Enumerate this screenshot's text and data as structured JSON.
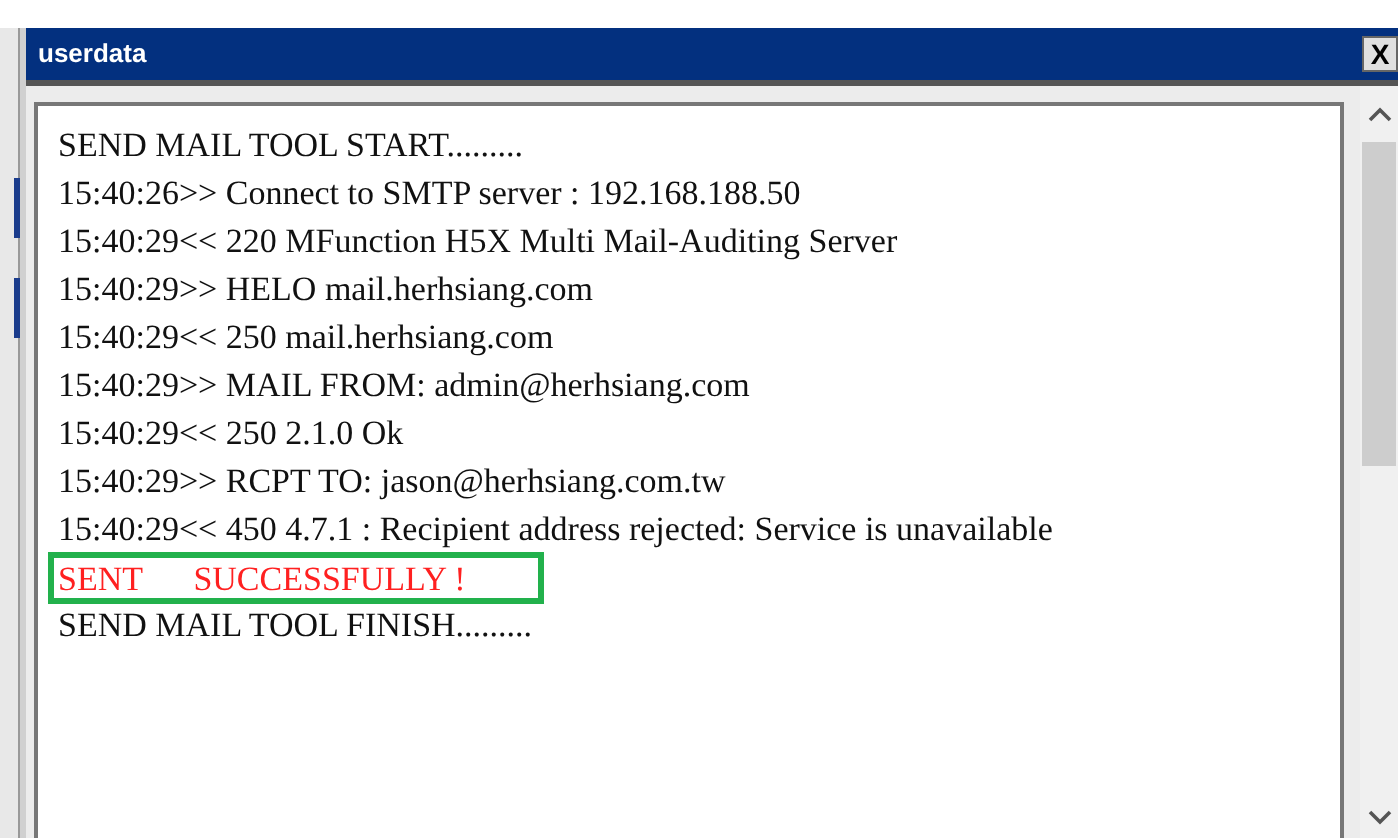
{
  "window": {
    "title": "userdata",
    "close_label": "X"
  },
  "log_lines": [
    {
      "text": "SEND MAIL TOOL START.........",
      "kind": "normal"
    },
    {
      "text": "15:40:26>> Connect to SMTP server : 192.168.188.50",
      "kind": "normal"
    },
    {
      "text": "15:40:29<< 220 MFunction H5X Multi Mail-Auditing Server",
      "kind": "normal"
    },
    {
      "text": "15:40:29>> HELO mail.herhsiang.com",
      "kind": "normal"
    },
    {
      "text": "15:40:29<< 250 mail.herhsiang.com",
      "kind": "normal"
    },
    {
      "text": "15:40:29>> MAIL FROM: admin@herhsiang.com",
      "kind": "normal"
    },
    {
      "text": "15:40:29<< 250 2.1.0 Ok",
      "kind": "normal"
    },
    {
      "text": "15:40:29>> RCPT TO: jason@herhsiang.com.tw",
      "kind": "normal"
    },
    {
      "text": "15:40:29<< 450 4.7.1 : Recipient address rejected: Service is unavailable",
      "kind": "normal"
    },
    {
      "text": "SENT      SUCCESSFULLY !",
      "kind": "highlight"
    },
    {
      "text": "SEND MAIL TOOL FINISH.........",
      "kind": "normal"
    }
  ]
}
